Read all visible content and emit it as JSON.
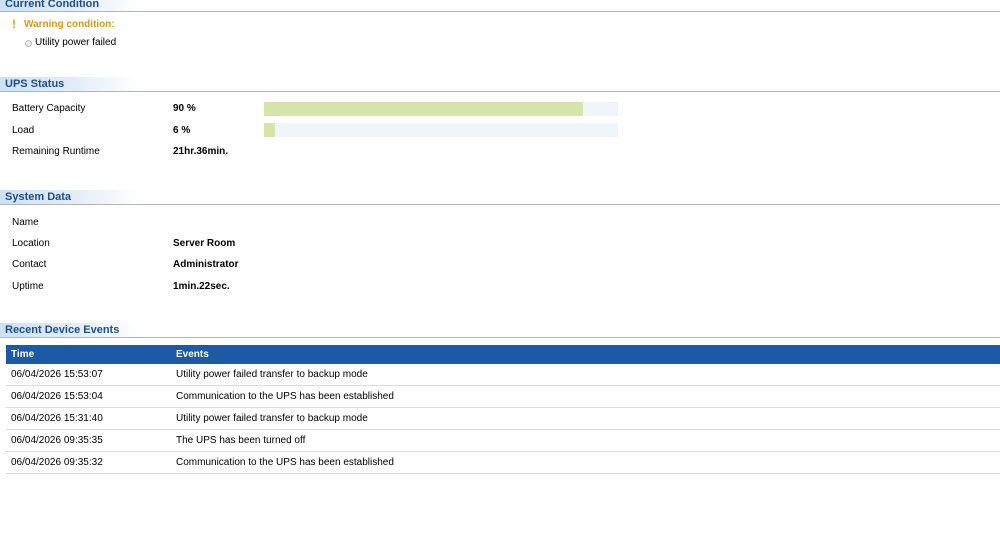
{
  "current_condition": {
    "title": "Current Condition",
    "warning_title": "Warning condition:",
    "warning_icon": "exclamation-icon",
    "items": [
      "Utility power failed"
    ]
  },
  "ups_status": {
    "title": "UPS Status",
    "rows": [
      {
        "label": "Battery Capacity",
        "value": "90 %",
        "bar_percent": 90
      },
      {
        "label": "Load",
        "value": "6 %",
        "bar_percent": 3
      },
      {
        "label": "Remaining Runtime",
        "value": "21hr.36min."
      }
    ],
    "bar_color": "#d5e4a9",
    "track_color": "#eef5fb"
  },
  "system_data": {
    "title": "System Data",
    "rows": [
      {
        "label": "Name",
        "value": ""
      },
      {
        "label": "Location",
        "value": "Server Room"
      },
      {
        "label": "Contact",
        "value": "Administrator"
      },
      {
        "label": "Uptime",
        "value": "1min.22sec."
      }
    ]
  },
  "recent_events": {
    "title": "Recent Device Events",
    "columns": [
      "Time",
      "Events"
    ],
    "rows": [
      [
        "06/04/2026 15:53:07",
        "Utility power failed transfer to backup mode"
      ],
      [
        "06/04/2026 15:53:04",
        "Communication to the UPS has been established"
      ],
      [
        "06/04/2026 15:31:40",
        "Utility power failed transfer to backup mode"
      ],
      [
        "06/04/2026 09:35:35",
        "The UPS has been turned off"
      ],
      [
        "06/04/2026 09:35:32",
        "Communication to the UPS has been established"
      ]
    ],
    "header_color": "#1d5aa5"
  }
}
